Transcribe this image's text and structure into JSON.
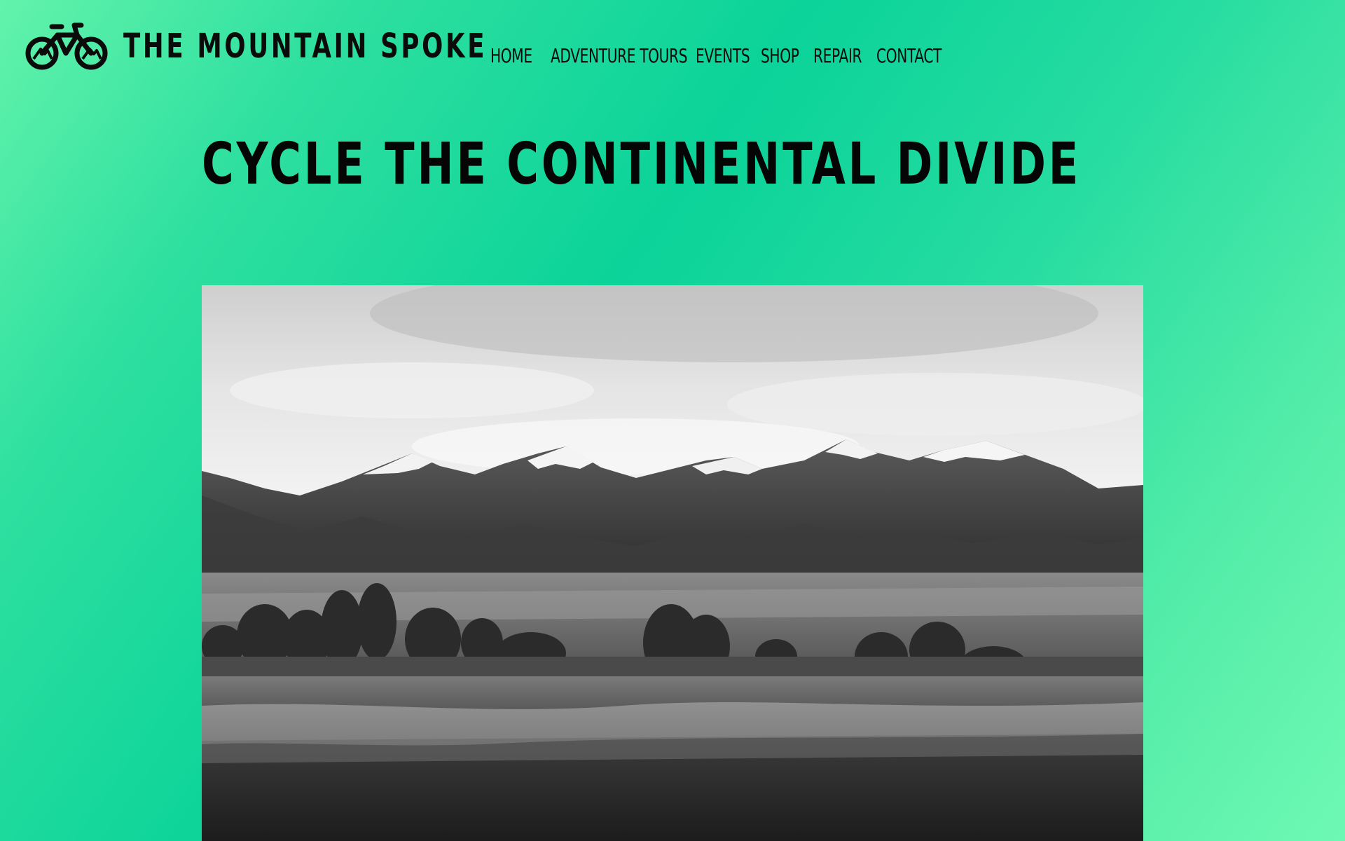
{
  "header": {
    "brand": "THE MOUNTAIN SPOKE",
    "logo_icon": "bicycle-mountain-icon"
  },
  "nav": {
    "items": [
      {
        "label": "HOME"
      },
      {
        "label": "ADVENTURE TOURS"
      },
      {
        "label": "EVENTS"
      },
      {
        "label": "SHOP"
      },
      {
        "label": "REPAIR"
      },
      {
        "label": "CONTACT"
      }
    ]
  },
  "main": {
    "title": "CYCLE THE CONTINENTAL DIVIDE",
    "hero_image": "black-and-white mountain landscape photo"
  },
  "colors": {
    "background_start": "#62f3ab",
    "background_mid": "#0bd399",
    "text": "#0b0b0b"
  }
}
